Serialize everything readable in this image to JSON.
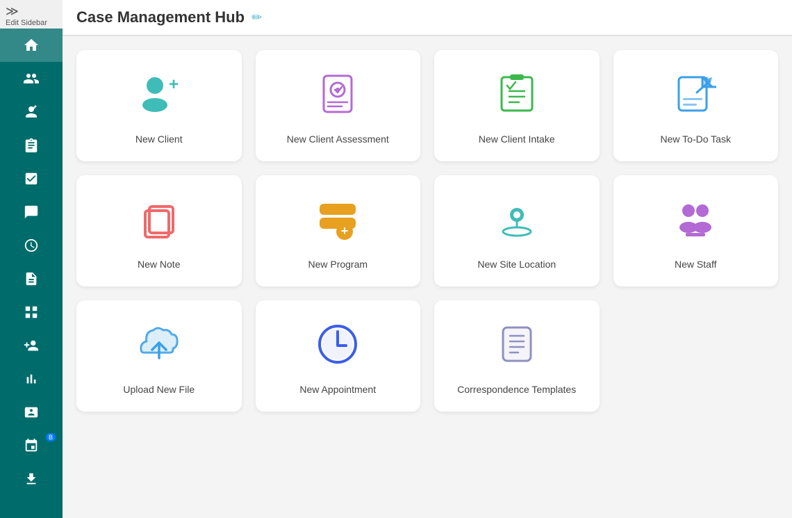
{
  "header": {
    "title": "Case Management Hub",
    "edit_icon": "✏"
  },
  "sidebar": {
    "edit_label": "Edit Sidebar",
    "items": [
      {
        "name": "home",
        "icon": "🏠",
        "active": true
      },
      {
        "name": "clients",
        "icon": "👥"
      },
      {
        "name": "user-edit",
        "icon": "👤"
      },
      {
        "name": "clipboard",
        "icon": "📋"
      },
      {
        "name": "tasks",
        "icon": "📝"
      },
      {
        "name": "notes",
        "icon": "📄"
      },
      {
        "name": "clock",
        "icon": "🕐"
      },
      {
        "name": "file",
        "icon": "📄"
      },
      {
        "name": "grid",
        "icon": "⊞"
      },
      {
        "name": "person-add",
        "icon": "👤"
      },
      {
        "name": "chart",
        "icon": "📊"
      },
      {
        "name": "contact",
        "icon": "📇"
      },
      {
        "name": "calendar",
        "icon": "📅",
        "badge": "B"
      },
      {
        "name": "download",
        "icon": "⬇"
      }
    ]
  },
  "cards": {
    "row1": [
      {
        "id": "new-client",
        "label": "New Client",
        "color": "#3fbcb8"
      },
      {
        "id": "new-client-assessment",
        "label": "New Client Assessment",
        "color": "#b36ad4"
      },
      {
        "id": "new-client-intake",
        "label": "New Client Intake",
        "color": "#3cb84b"
      },
      {
        "id": "new-todo-task",
        "label": "New To-Do Task",
        "color": "#3b9fe8"
      }
    ],
    "row2": [
      {
        "id": "new-note",
        "label": "New Note",
        "color": "#f0696a"
      },
      {
        "id": "new-program",
        "label": "New Program",
        "color": "#e8a020"
      },
      {
        "id": "new-site-location",
        "label": "New Site Location",
        "color": "#3fbcb8"
      },
      {
        "id": "new-staff",
        "label": "New Staff",
        "color": "#b36ad4"
      }
    ],
    "row3": [
      {
        "id": "upload-new-file",
        "label": "Upload New File",
        "color": "#3b9fe8"
      },
      {
        "id": "new-appointment",
        "label": "New Appointment",
        "color": "#3b9fe8"
      },
      {
        "id": "correspondence-templates",
        "label": "Correspondence Templates",
        "color": "#9090c0"
      }
    ]
  }
}
